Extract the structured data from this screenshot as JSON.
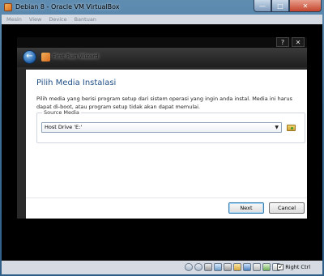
{
  "window": {
    "title": "Debian 8 - Oracle VM VirtualBox",
    "min_glyph": "—",
    "max_glyph": "□",
    "close_glyph": "✕"
  },
  "menu": {
    "items": [
      "Mesin",
      "View",
      "Device",
      "Bantuan"
    ]
  },
  "wizard": {
    "help_glyph": "?",
    "close_glyph": "✕",
    "back_glyph": "←",
    "title": "First Run Wizard",
    "heading": "Pilih Media Instalasi",
    "description": "Pilih media yang berisi program setup dari sistem operasi yang ingin anda instal. Media ini harus dapat di-boot, atau program setup tidak akan dapat memulai.",
    "source_media_label": "Source Media",
    "source_media_value": "Host Drive 'E:'",
    "chevron_glyph": "▼",
    "next_label": "Next",
    "cancel_label": "Cancel"
  },
  "statusbar": {
    "host_key_label": "Right Ctrl",
    "host_key_glyph": "↙"
  }
}
